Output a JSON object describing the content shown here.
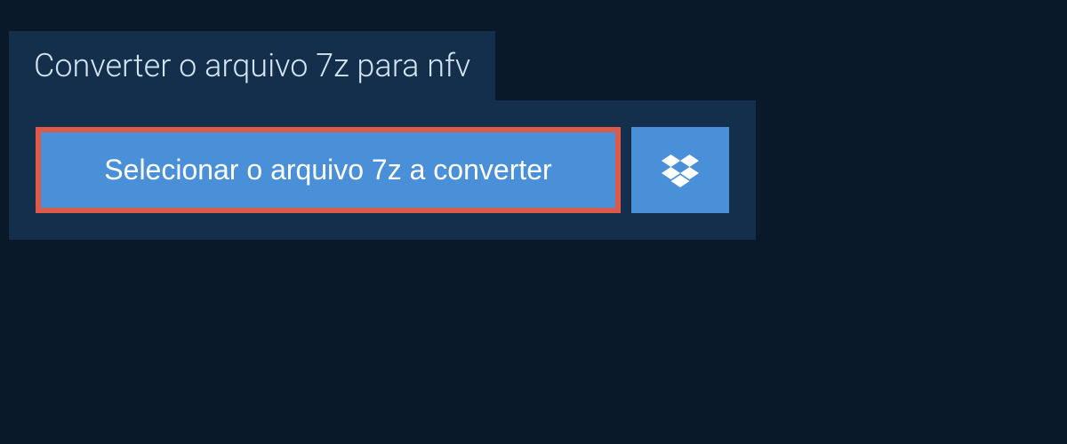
{
  "header": {
    "title": "Converter o arquivo 7z para nfv"
  },
  "upload": {
    "select_button_label": "Selecionar o arquivo 7z a converter"
  }
}
